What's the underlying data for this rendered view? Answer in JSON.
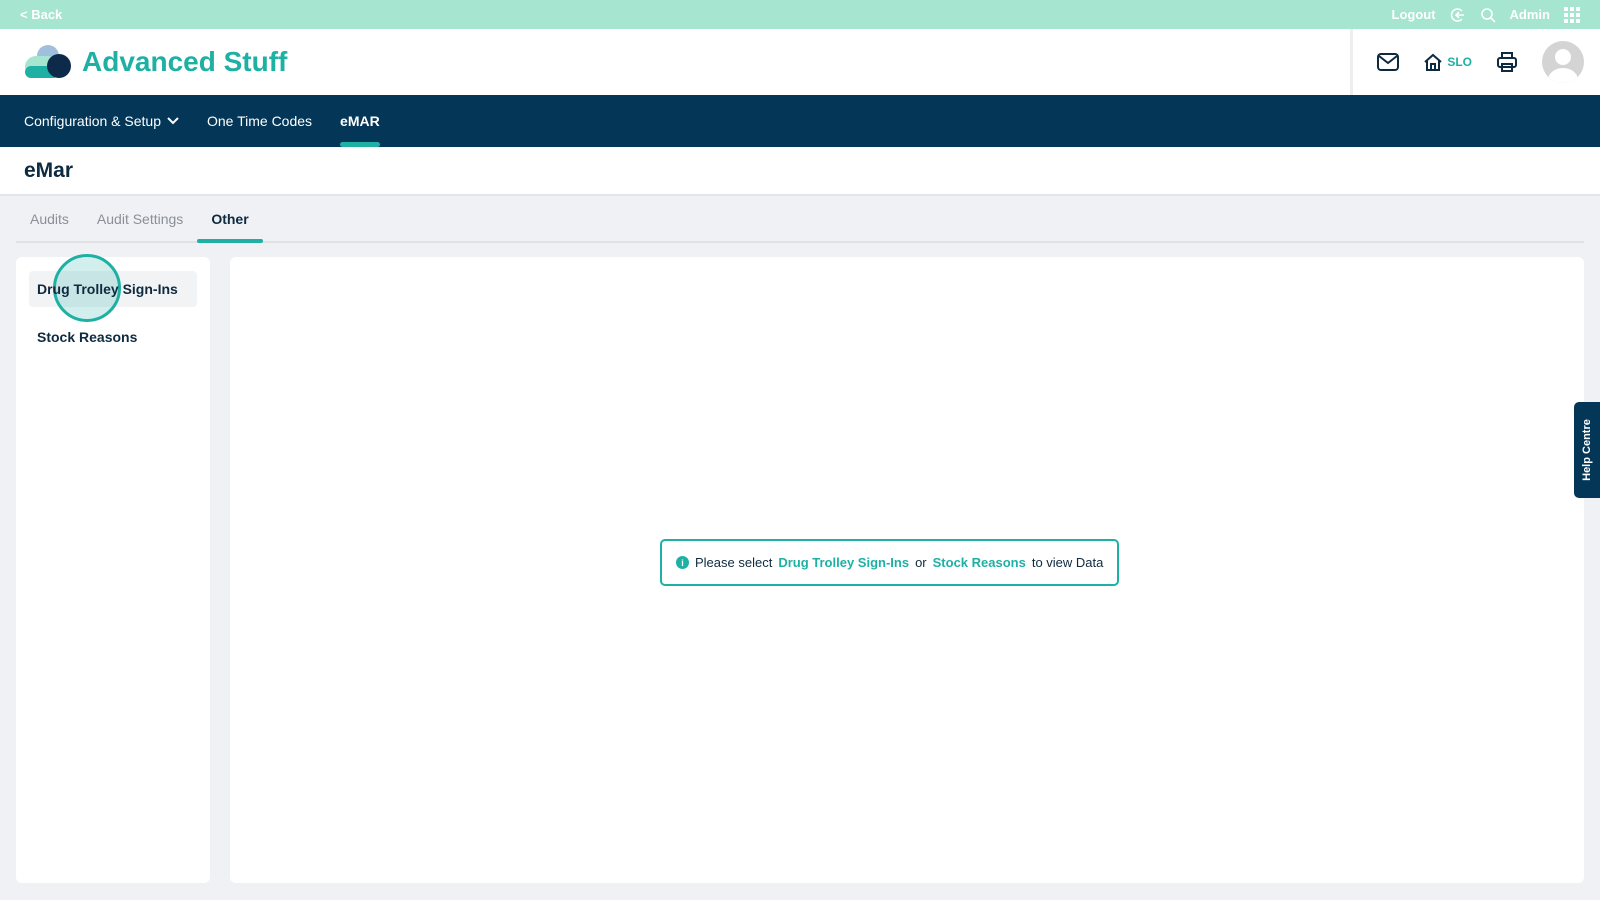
{
  "topbar": {
    "back": "< Back",
    "logout": "Logout",
    "user": "Admin"
  },
  "header": {
    "brand": "Advanced Stuff",
    "home_label": "SLO"
  },
  "nav": {
    "items": [
      {
        "label": "Configuration & Setup"
      },
      {
        "label": "One Time Codes"
      },
      {
        "label": "eMAR"
      }
    ]
  },
  "page": {
    "title": "eMar"
  },
  "tabs": [
    {
      "label": "Audits"
    },
    {
      "label": "Audit Settings"
    },
    {
      "label": "Other"
    }
  ],
  "sidebar": {
    "items": [
      {
        "label": "Drug Trolley Sign-Ins"
      },
      {
        "label": "Stock Reasons"
      }
    ]
  },
  "message": {
    "prefix": "Please select",
    "link1": "Drug Trolley Sign-Ins",
    "mid": "or",
    "link2": "Stock Reasons",
    "suffix": "to view Data",
    "icon_text": "i"
  },
  "help": {
    "label": "Help Centre"
  },
  "colors": {
    "accent": "#1fb0a4",
    "navy": "#033657",
    "topbar": "#a6e5cf"
  }
}
